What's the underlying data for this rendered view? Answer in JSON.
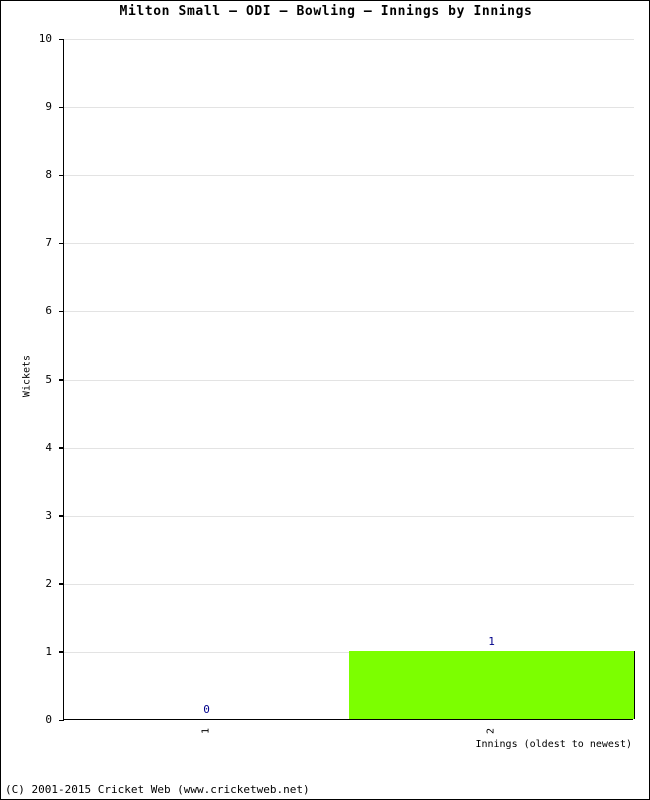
{
  "chart_data": {
    "type": "bar",
    "title": "Milton Small – ODI – Bowling – Innings by Innings",
    "xlabel": "Innings (oldest to newest)",
    "ylabel": "Wickets",
    "categories": [
      "1",
      "2"
    ],
    "values": [
      0,
      1
    ],
    "point_labels": [
      "0",
      "1"
    ],
    "ylim": [
      0,
      10
    ],
    "yticks": [
      0,
      1,
      2,
      3,
      4,
      5,
      6,
      7,
      8,
      9,
      10
    ],
    "ytick_labels": [
      "0",
      "1",
      "2",
      "3",
      "4",
      "5",
      "6",
      "7",
      "8",
      "9",
      "10"
    ],
    "grid": true,
    "legend": null,
    "series": [
      {
        "name": "Wickets",
        "values": [
          0,
          1
        ],
        "color": "#7cff00"
      }
    ],
    "bar_color": "#7cff00",
    "label_color": "#00008b",
    "grid_color": "#e3e3e3",
    "axis_color": "#000000"
  },
  "footer": {
    "copyright": "(C) 2001-2015 Cricket Web (www.cricketweb.net)"
  }
}
